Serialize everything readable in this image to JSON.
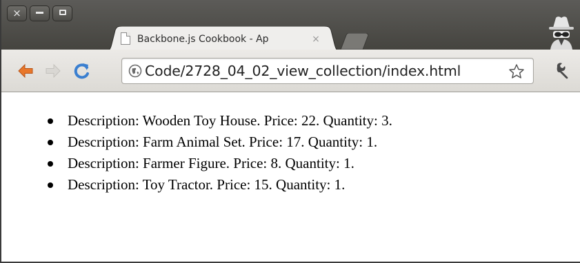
{
  "window": {
    "controls": {
      "close": "×",
      "minimize": "–",
      "maximize": "□"
    }
  },
  "tab": {
    "title": "Backbone.js Cookbook - Ap",
    "close": "×",
    "icon": "page-icon"
  },
  "toolbar": {
    "back_icon": "back-arrow-icon",
    "forward_icon": "forward-arrow-icon",
    "reload_icon": "reload-icon",
    "url": "Code/2728_04_02_view_collection/index.html",
    "star_icon": "bookmark-star-icon",
    "menu_icon": "wrench-icon"
  },
  "incognito_icon": "incognito-icon",
  "colors": {
    "back_arrow": "#e8772a",
    "reload": "#3a7fd0",
    "titlebar": "#4f4e4a"
  },
  "page": {
    "items": [
      {
        "text": "Description: Wooden Toy House. Price: 22. Quantity: 3."
      },
      {
        "text": "Description: Farm Animal Set. Price: 17. Quantity: 1."
      },
      {
        "text": "Description: Farmer Figure. Price: 8. Quantity: 1."
      },
      {
        "text": "Description: Toy Tractor. Price: 15. Quantity: 1."
      }
    ]
  }
}
